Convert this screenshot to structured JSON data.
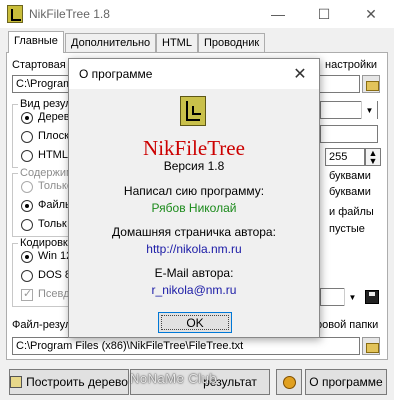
{
  "window": {
    "title": "NikFileTree 1.8",
    "minimize": "—",
    "maximize": "☐",
    "close": "✕"
  },
  "tabs": [
    "Главные",
    "Дополнительно",
    "HTML",
    "Проводник"
  ],
  "main": {
    "start_folder_label": "Стартовая",
    "start_folder_value": "C:\\Program",
    "settings_label": "настройки",
    "view_group": {
      "label": "Вид резул",
      "options": [
        "Дерево",
        "Плоски",
        "HTML-с"
      ]
    },
    "content_group": {
      "label": "Содержим",
      "options": [
        "Только",
        "Файлы",
        "Тольк"
      ]
    },
    "encoding_group": {
      "label": "Кодировк",
      "options": [
        "Win 125",
        "DOS 86"
      ],
      "pseudo_label": "Псевдо"
    },
    "depth_value": "255",
    "right_texts": [
      "буквами",
      "буквами",
      "и файлы",
      "пустые"
    ],
    "result_file_label": "Файл-резуль",
    "result_folder_label": "ровой папки",
    "result_file_value": "C:\\Program Files (x86)\\NikFileTree\\FileTree.txt"
  },
  "buttons": {
    "build_tree": "Построить дерево",
    "result": "результат",
    "about": "О программе"
  },
  "dialog": {
    "title": "О программе",
    "app_name": "NikFileTree",
    "version": "Версия 1.8",
    "author_caption": "Написал сию программу:",
    "author_name": "Рябов Николай",
    "homepage_caption": "Домашняя страничка автора:",
    "homepage_url": "http://nikola.nm.ru",
    "email_caption": "E-Mail автора:",
    "email": "r_nikola@nm.ru",
    "ok_label": "OK"
  },
  "watermark": "NoNaMe Club",
  "colors": {
    "app_name": "#cc0000",
    "author_name": "#1a8a1a",
    "link": "#1a1aa6"
  }
}
